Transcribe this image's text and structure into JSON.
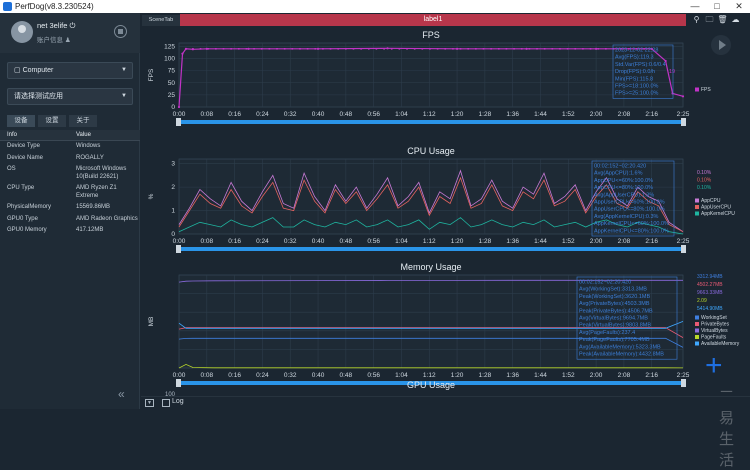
{
  "app": {
    "title": "PerfDog(v8.3.230524)"
  },
  "user": {
    "name": "net 3elife",
    "account_info": "账户信息"
  },
  "device_select": {
    "value": "Computer"
  },
  "app_select": {
    "value": "请选择测试应用"
  },
  "tabs": [
    "设备",
    "设置",
    "关于"
  ],
  "info_table": {
    "header": {
      "key": "Info",
      "value": "Value"
    },
    "rows": [
      {
        "key": "Device Type",
        "value": "Windows"
      },
      {
        "key": "Device Name",
        "value": "ROGALLY"
      },
      {
        "key": "OS",
        "value": "Microsoft Windows 10(Build 22621)"
      },
      {
        "key": "CPU Type",
        "value": "AMD Ryzen Z1 Extreme"
      },
      {
        "key": "PhysicalMemory",
        "value": "15569.86MB"
      },
      {
        "key": "GPU0 Type",
        "value": "AMD Radeon Graphics"
      },
      {
        "key": "GPU0 Memory",
        "value": "417.12MB"
      }
    ]
  },
  "scene_tab": "SceneTab",
  "label_bar": "label1",
  "log": {
    "label": "Log"
  },
  "watermark": "三易生活",
  "colors": {
    "accent": "#1d6fd8",
    "fps": "#c233c7",
    "label": "#b7364b",
    "stats": "#3c7fd9"
  },
  "icons": [
    "location-icon",
    "folder-icon",
    "trash-icon",
    "cloud-icon",
    "play-icon",
    "plus-icon",
    "collapse-icon"
  ],
  "chart_data": [
    {
      "type": "line",
      "title": "FPS",
      "ylabel": "FPS",
      "yticks": [
        0,
        25,
        50,
        75,
        100,
        125
      ],
      "ylim": [
        0,
        132
      ],
      "xticks": [
        "0:00",
        "0:08",
        "0:16",
        "0:24",
        "0:32",
        "0:40",
        "0:48",
        "0:56",
        "1:04",
        "1:12",
        "1:20",
        "1:28",
        "1:36",
        "1:44",
        "1:52",
        "2:00",
        "2:08",
        "2:16",
        "2:25"
      ],
      "x": [
        0,
        1,
        2,
        4,
        8,
        20,
        40,
        60,
        80,
        100,
        120,
        136,
        140,
        142,
        145
      ],
      "series": [
        {
          "name": "FPS",
          "values": [
            0,
            110,
            120,
            119,
            120,
            120,
            120,
            121,
            120,
            120,
            120,
            120,
            95,
            28,
            22
          ]
        }
      ],
      "stats": [
        "2023-12-02 22:28",
        "Avg(FPS):119.3",
        "Std.Var(FPS):0.6/0.4",
        "Drop(FPS):0.0/h",
        "Min(FPS):115.8",
        "FPS>=18:100.0%",
        "FPS>=25:100.0%"
      ],
      "current_value": "19"
    },
    {
      "type": "line",
      "title": "CPU Usage",
      "ylabel": "%",
      "yticks": [
        0,
        1,
        2,
        3
      ],
      "ylim": [
        0,
        3.2
      ],
      "xticks": [
        "0:00",
        "0:08",
        "0:16",
        "0:24",
        "0:32",
        "0:40",
        "0:48",
        "0:56",
        "1:04",
        "1:12",
        "1:20",
        "1:28",
        "1:36",
        "1:44",
        "1:52",
        "2:00",
        "2:08",
        "2:16",
        "2:25"
      ],
      "x": [
        0,
        3,
        6,
        9,
        12,
        15,
        18,
        21,
        24,
        27,
        30,
        33,
        36,
        39,
        42,
        45,
        48,
        51,
        54,
        57,
        60,
        63,
        66,
        69,
        72,
        75,
        78,
        81,
        84,
        87,
        90,
        93,
        96,
        99,
        102,
        105,
        108,
        111,
        114,
        117,
        120,
        123,
        126,
        129,
        132,
        135,
        138,
        141,
        145
      ],
      "series": [
        {
          "name": "AppCPU",
          "values": [
            0.4,
            1.1,
            1.9,
            1.5,
            1.2,
            2.2,
            1.4,
            1.0,
            1.8,
            2.5,
            1.3,
            1.1,
            2.6,
            1.6,
            1.0,
            2.1,
            1.4,
            2.0,
            1.1,
            1.7,
            2.4,
            1.2,
            1.6,
            2.2,
            0.9,
            1.8,
            1.5,
            2.7,
            1.2,
            1.5,
            2.3,
            1.4,
            1.1,
            2.0,
            1.7,
            2.6,
            1.3,
            1.6,
            2.1,
            1.0,
            1.8,
            2.4,
            1.5,
            1.2,
            2.0,
            1.6,
            1.4,
            0.5,
            0.1
          ]
        },
        {
          "name": "AppUserCPU",
          "values": [
            0.3,
            1.0,
            1.7,
            1.3,
            1.1,
            1.9,
            1.2,
            0.9,
            1.6,
            2.2,
            1.1,
            1.0,
            2.3,
            1.4,
            0.9,
            1.9,
            1.3,
            1.8,
            1.0,
            1.5,
            2.1,
            1.1,
            1.4,
            2.0,
            0.8,
            1.6,
            1.3,
            2.4,
            1.1,
            1.3,
            2.1,
            1.2,
            1.0,
            1.8,
            1.5,
            2.3,
            1.2,
            1.4,
            1.9,
            0.9,
            1.6,
            2.1,
            1.3,
            1.1,
            1.8,
            1.4,
            1.2,
            0.4,
            0.1
          ]
        },
        {
          "name": "AppKernelCPU",
          "values": [
            0.1,
            0.3,
            0.5,
            0.4,
            0.3,
            0.6,
            0.4,
            0.3,
            0.5,
            0.7,
            0.3,
            0.3,
            0.6,
            0.4,
            0.3,
            0.5,
            0.4,
            0.6,
            0.3,
            0.4,
            0.6,
            0.3,
            0.4,
            0.6,
            0.2,
            0.5,
            0.4,
            0.7,
            0.3,
            0.4,
            0.6,
            0.4,
            0.3,
            0.5,
            0.4,
            0.6,
            0.3,
            0.4,
            0.5,
            0.3,
            0.5,
            0.6,
            0.4,
            0.3,
            0.5,
            0.4,
            0.3,
            0.1,
            0.0
          ]
        }
      ],
      "current_values": [
        "0.10%",
        "0.10%",
        "0.10%"
      ],
      "stats": [
        "00:02:152~02:20.420",
        "Avg(AppCPU):1.6%",
        "AppCPU<=60%:100.0%",
        "AppCPU<=80%:100.0%",
        "Avg(AppUserCPU):1.3%",
        "AppUserCPU<=60%:100.0%",
        "AppUserCPU<=80%:100.0%",
        "Avg(AppKernelCPU):0.3%",
        "AppKernelCPU<=60%:100.0%",
        "AppKernelCPU<=80%:100.0%"
      ]
    },
    {
      "type": "line",
      "title": "Memory Usage",
      "ylabel": "MB",
      "xticks": [
        "0:00",
        "0:08",
        "0:16",
        "0:24",
        "0:32",
        "0:40",
        "0:48",
        "0:56",
        "1:04",
        "1:12",
        "1:20",
        "1:28",
        "1:36",
        "1:44",
        "1:52",
        "2:00",
        "2:08",
        "2:16",
        "2:25"
      ],
      "x": [
        0,
        2,
        4,
        10,
        40,
        60,
        80,
        100,
        120,
        140,
        145
      ],
      "series": [
        {
          "name": "WorkingSet",
          "values": [
            3230,
            3310,
            3313,
            3313,
            3313,
            3313,
            3313,
            3313,
            3313,
            3313,
            2300
          ]
        },
        {
          "name": "PrivateBytes",
          "values": [
            4350,
            4500,
            4503,
            4503,
            4503,
            4503,
            4503,
            4503,
            4503,
            4503,
            3400
          ]
        },
        {
          "name": "VirtualBytes",
          "values": [
            9600,
            9700,
            9720,
            9740,
            9760,
            9780,
            9790,
            9800,
            9800,
            9800,
            9800
          ]
        },
        {
          "name": "PageFaults",
          "values": [
            0,
            400,
            60,
            20,
            22,
            21,
            20,
            22,
            20,
            21,
            15
          ]
        },
        {
          "name": "AvailableMemory",
          "values": [
            5000,
            4432,
            4432,
            4432,
            4432,
            4432,
            4432,
            4432,
            4432,
            4432,
            5200
          ]
        }
      ],
      "current_values": [
        "3312.94MB",
        "4502.27MB",
        "9663.33MB",
        "2.09",
        "5414.90MB"
      ],
      "stats": [
        "00:02:152~02:20.420",
        "Avg(WorkingSet):3313.3MB",
        "Peak(WorkingSet):3620.1MB",
        "Avg(PrivateBytes):4503.3MB",
        "Peak(PrivateBytes):4506.7MB",
        "Avg(VirtualBytes):9694.7MB",
        "Peak(VirtualBytes):9803.8MB",
        "Avg(PageFaults):237.4",
        "Peak(PageFaults):7705.4MB",
        "Avg(AvailableMemory):5323.3MB",
        "Peak(AvailableMemory):4432.8MB"
      ]
    },
    {
      "type": "line",
      "title": "GPU Usage",
      "yticks": [
        100
      ]
    }
  ]
}
